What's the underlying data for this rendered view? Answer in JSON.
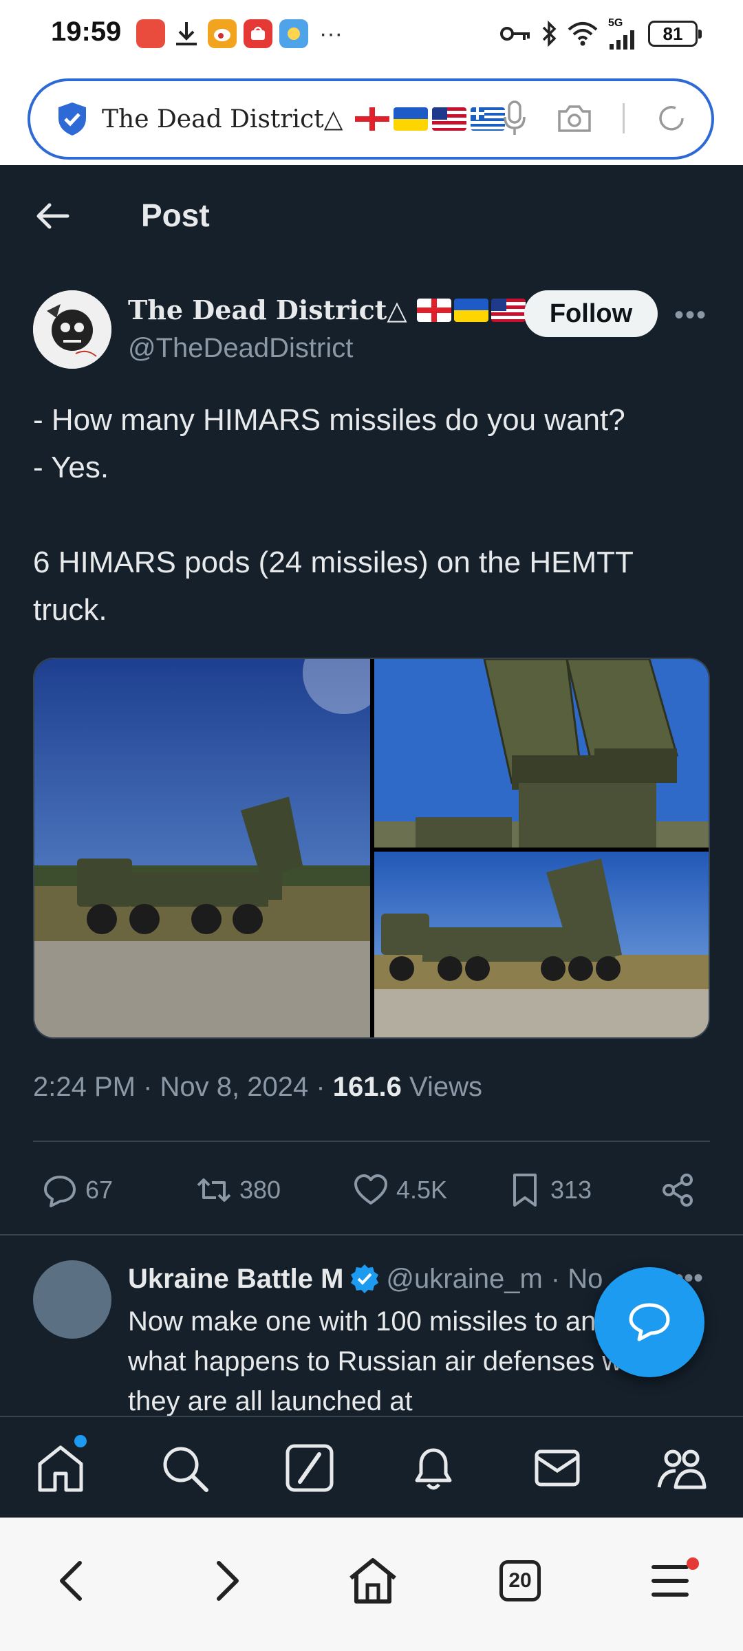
{
  "status_bar": {
    "time": "19:59",
    "network": "5G",
    "battery": "81"
  },
  "browser": {
    "address_text": "The Dead District△",
    "tabs_count": "20"
  },
  "header": {
    "title": "Post"
  },
  "post": {
    "author_name": "The Dead District△",
    "author_handle": "@TheDeadDistrict",
    "follow_label": "Follow",
    "text_lines": [
      "- How many HIMARS missiles do you want?",
      "- Yes.",
      "6 HIMARS pods (24 missiles) on the HEMTT truck."
    ],
    "time": "2:24 PM",
    "date": "Nov 8, 2024",
    "views_count": "161.6",
    "views_label": "Views",
    "actions": {
      "replies": "67",
      "reposts": "380",
      "likes": "4.5K",
      "bookmarks": "313"
    }
  },
  "reply": {
    "name": "Ukraine Battle M",
    "handle": "@ukraine_m",
    "time": "· No",
    "text": "Now make one with 100 missiles to and see what happens to Russian air defenses when they are all launched at"
  },
  "colors": {
    "background": "#15202b",
    "accent": "#1d9bf0",
    "text": "#e7e9ea",
    "muted": "#8b98a5",
    "border": "#38444d"
  }
}
